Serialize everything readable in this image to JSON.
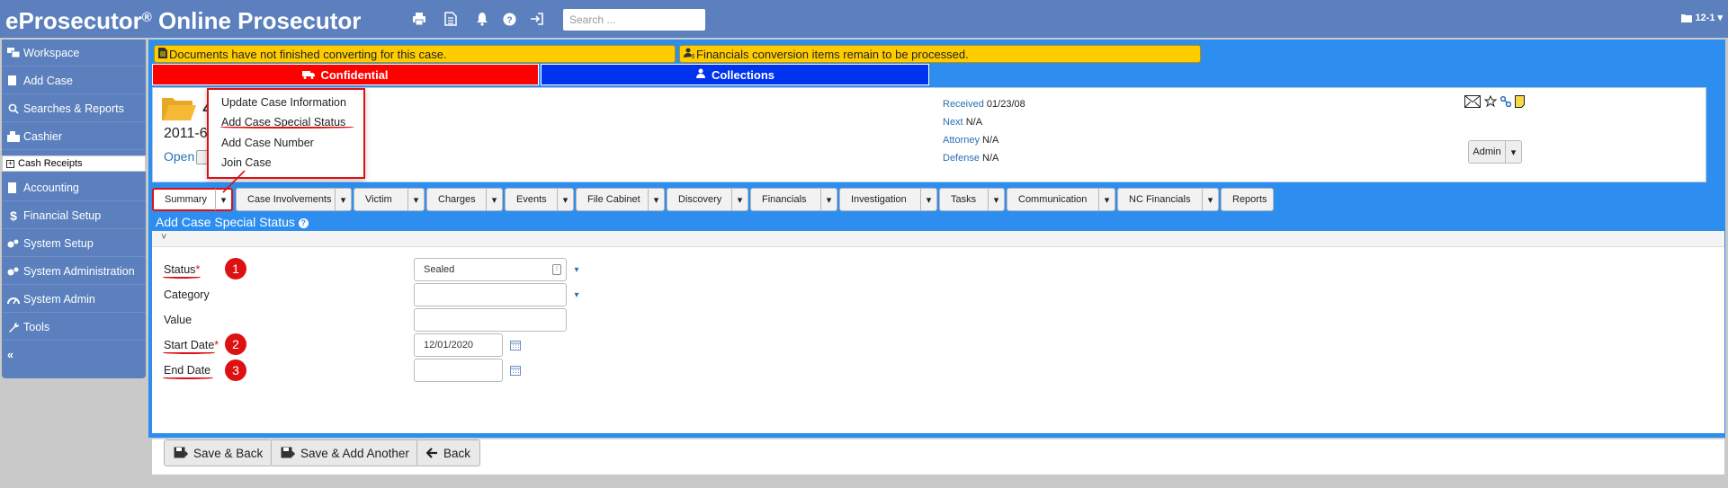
{
  "app": {
    "brand_main": "eProsecutor",
    "brand_reg": "®",
    "brand_rest": " Online Prosecutor",
    "user_menu": "12-1",
    "search_placeholder": "Search ..."
  },
  "topbar_icons": [
    "print-icon",
    "document-icon",
    "bell-icon",
    "help-icon",
    "sign-out-icon"
  ],
  "sidebar": {
    "items": [
      {
        "label": "Workspace",
        "icon": "workspace-icon"
      },
      {
        "label": "Add Case",
        "icon": "add-case-icon"
      },
      {
        "label": "Searches & Reports",
        "icon": "search-icon"
      },
      {
        "label": "Cashier",
        "icon": "cashier-icon"
      },
      {
        "label": "Cash Receipts",
        "icon": "plus-square-icon"
      },
      {
        "label": "Accounting",
        "icon": "accounting-icon"
      },
      {
        "label": "Financial Setup",
        "icon": "dollar-icon"
      },
      {
        "label": "System Setup",
        "icon": "gears-icon"
      },
      {
        "label": "System Administration",
        "icon": "gears-icon"
      },
      {
        "label": "System Admin",
        "icon": "dashboard-icon"
      },
      {
        "label": "Tools",
        "icon": "wrench-icon"
      }
    ],
    "collapse_label": "«"
  },
  "alerts": {
    "documents": "Documents have not finished converting for this case.",
    "financials": "Financials conversion items remain to be processed."
  },
  "flags": {
    "confidential": "Confidential",
    "collections": "Collections"
  },
  "case": {
    "number_start": "4",
    "number_line": "2011-6",
    "status": "Open",
    "received_label": "Received",
    "received_value": "01/23/08",
    "next_label": "Next",
    "next_value": "N/A",
    "attorney_label": "Attorney",
    "attorney_value": "N/A",
    "defense_label": "Defense",
    "defense_value": "N/A",
    "admin_label": "Admin"
  },
  "dropdown": {
    "items": [
      "Update Case Information",
      "Add Case Special Status",
      "Add Case Number",
      "Join Case"
    ]
  },
  "tabs": [
    {
      "label": "Summary",
      "caret": true
    },
    {
      "label": "Case Involvements",
      "caret": true
    },
    {
      "label": "Victim",
      "caret": true
    },
    {
      "label": "Charges",
      "caret": true
    },
    {
      "label": "Events",
      "caret": true
    },
    {
      "label": "File Cabinet",
      "caret": true
    },
    {
      "label": "Discovery",
      "caret": true
    },
    {
      "label": "Financials",
      "caret": true
    },
    {
      "label": "Investigation",
      "caret": true
    },
    {
      "label": "Tasks",
      "caret": true
    },
    {
      "label": "Communication",
      "caret": true
    },
    {
      "label": "NC Financials",
      "caret": true
    },
    {
      "label": "Reports",
      "caret": false
    }
  ],
  "section": {
    "title": "Add Case Special Status",
    "collapse_glyph": "˅"
  },
  "form": {
    "status_label": "Status",
    "status_value": "Sealed",
    "category_label": "Category",
    "category_value": "",
    "value_label": "Value",
    "value_value": "",
    "start_label": "Start Date",
    "start_value": "12/01/2020",
    "end_label": "End Date",
    "end_value": "",
    "required_mark": "*",
    "step_1": "1",
    "step_2": "2",
    "step_3": "3"
  },
  "buttons": {
    "save_back": "Save & Back",
    "save_add": "Save & Add Another",
    "back": "Back"
  },
  "colors": {
    "brand_bar": "#5b80bd",
    "panel_blue": "#2e8ef0",
    "alert_yellow": "#ffcc00",
    "confidential_red": "#ff0000",
    "collections_blue": "#0033ee",
    "annotation_red": "#dd1111"
  }
}
